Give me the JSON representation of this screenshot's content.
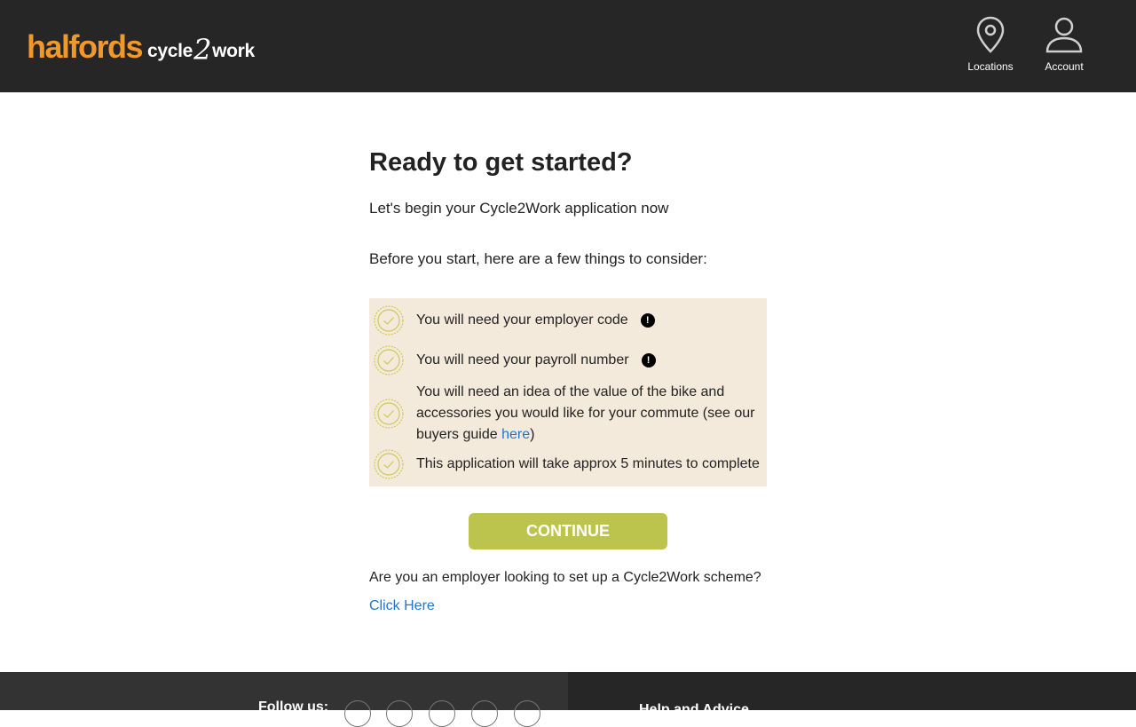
{
  "header": {
    "logo": "halfords",
    "sublogo_left": "cycle",
    "sublogo_two": "2",
    "sublogo_right": "work",
    "locations_label": "Locations",
    "account_label": "Account"
  },
  "main": {
    "title": "Ready to get started?",
    "intro": "Let's begin your Cycle2Work application now",
    "consider": "Before you start, here are a few things to consider:",
    "checklist": {
      "item1": "You will need your employer code",
      "item2": "You will need your payroll number",
      "item3_before": "You will need an idea of the value of the bike and accessories you would like for your commute (see our buyers guide ",
      "item3_link": "here",
      "item3_after": ")",
      "item4": "This application will take approx 5 minutes to complete",
      "info_glyph": "!"
    },
    "continue_label": "CONTINUE",
    "employer_text": "Are you an employer looking to set up a Cycle2Work scheme?",
    "click_here": "Click Here"
  },
  "footer": {
    "follow_label": "Follow us:",
    "social_icons": [
      "instagram-icon",
      "facebook-icon",
      "twitter-icon",
      "youtube-icon",
      "video-icon"
    ],
    "help_label": "Help and Advice"
  },
  "colors": {
    "header_bg": "#262626",
    "brand_orange": "#f2982b",
    "checklist_bg": "#f4eadb",
    "continue_bg": "#bdc44e",
    "link": "#1f75cf"
  }
}
